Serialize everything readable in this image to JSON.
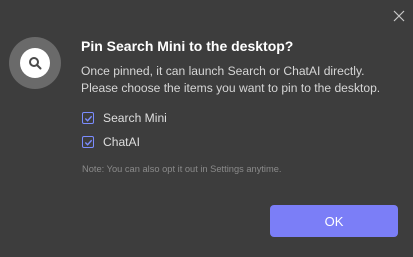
{
  "dialog": {
    "title": "Pin Search Mini to the desktop?",
    "description_line1": "Once pinned, it can launch Search or ChatAI directly.",
    "description_line2": "Please choose the items you want to pin to the desktop.",
    "options": [
      {
        "label": "Search Mini",
        "checked": true
      },
      {
        "label": "ChatAI",
        "checked": true
      }
    ],
    "note": "Note: You can also opt it out in Settings anytime.",
    "ok_label": "OK",
    "close_icon": "close-icon",
    "app_icon": "search-icon"
  },
  "colors": {
    "background": "#3d3d3d",
    "accent": "#7b7ef7",
    "checkbox": "#7b8cff",
    "logo_circle": "#6a6a6a"
  }
}
